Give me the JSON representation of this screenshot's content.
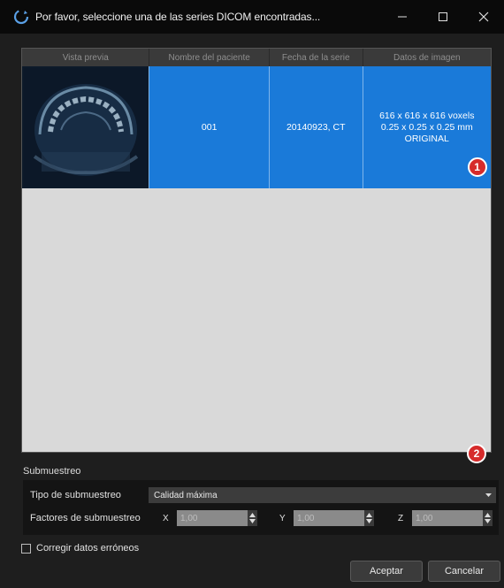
{
  "window": {
    "title": "Por favor, seleccione una de las series DICOM encontradas...",
    "icons": {
      "app": "refresh-circle-icon",
      "minimize": "minimize-icon",
      "maximize": "maximize-icon",
      "close": "close-icon"
    }
  },
  "table": {
    "headers": [
      "Vista previa",
      "Nombre del paciente",
      "Fecha de la serie",
      "Datos de imagen"
    ],
    "rows": [
      {
        "preview": "dental-ct-thumbnail",
        "patient_name": "001",
        "series_date": "20140923, CT",
        "image_data": [
          "616 x 616 x 616 voxels",
          "0.25 x 0.25 x 0.25 mm",
          "ORIGINAL"
        ]
      }
    ],
    "selection_color": "#1a7ad9"
  },
  "markers": {
    "one": "1",
    "two": "2",
    "color": "#d62b2b"
  },
  "subsampling": {
    "title": "Submuestreo",
    "type_label": "Tipo de submuestreo",
    "type_value": "Calidad máxima",
    "factors_label": "Factores de submuestreo",
    "x_label": "X",
    "x_value": "1,00",
    "y_label": "Y",
    "y_value": "1,00",
    "z_label": "Z",
    "z_value": "1,00"
  },
  "correct_data": {
    "label": "Corregir datos erróneos",
    "checked": false
  },
  "buttons": {
    "accept": "Aceptar",
    "cancel": "Cancelar"
  }
}
